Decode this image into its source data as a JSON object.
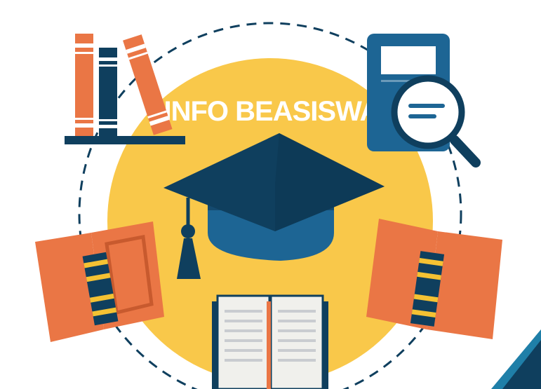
{
  "banner": {
    "title": "INFO BEASISWA"
  },
  "colors": {
    "background": "#ffffff",
    "circle_yellow": "#f9c84a",
    "navy": "#0f3f5e",
    "navy_dark": "#0c3550",
    "blue": "#1d6594",
    "orange": "#ea7645",
    "orange_dark": "#c85a2e",
    "gold": "#f4c233",
    "paper": "#f0f0ec",
    "paper_line": "#c9ccd0",
    "corner_teal": "#1f7fa8"
  },
  "icons": [
    "bookshelf-icon",
    "calculator-icon",
    "magnifier-icon",
    "graduation-cap-icon",
    "open-book-left-icon",
    "open-book-right-icon",
    "open-book-bottom-icon"
  ]
}
